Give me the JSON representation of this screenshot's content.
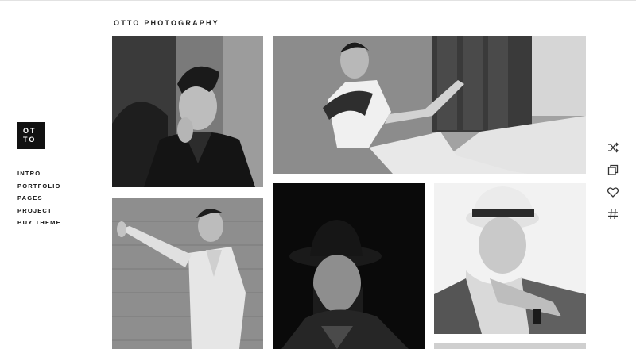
{
  "site": {
    "title": "OTTO PHOTOGRAPHY",
    "logo_line1": "OT",
    "logo_line2": "TO"
  },
  "nav": {
    "items": [
      {
        "label": "INTRO"
      },
      {
        "label": "PORTFOLIO"
      },
      {
        "label": "PAGES"
      },
      {
        "label": "PROJECT"
      },
      {
        "label": "BUY THEME"
      }
    ]
  },
  "gallery": {
    "photos": [
      {
        "subject": "man in leather jacket with hand on chin"
      },
      {
        "subject": "man with scarf sitting against wall"
      },
      {
        "subject": "man in light suit leaning on wall"
      },
      {
        "subject": "bearded man in black hat"
      },
      {
        "subject": "man in white hat with scarf"
      }
    ]
  },
  "side_icons": [
    "shuffle-icon",
    "copy-icon",
    "heart-icon",
    "hashtag-icon"
  ],
  "colors": {
    "text": "#111111",
    "background": "#ffffff",
    "logo_bg": "#111111"
  }
}
